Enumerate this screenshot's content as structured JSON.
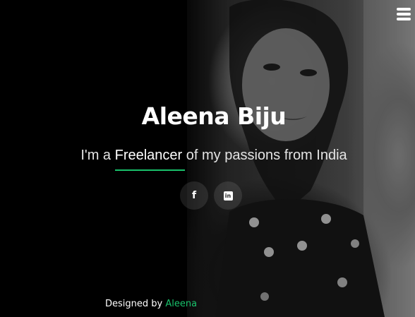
{
  "header": {
    "menu_icon": "hamburger-menu-icon"
  },
  "hero": {
    "name": "Aleena Biju",
    "tagline_prefix": "I'm a ",
    "tagline_highlight": "Freelancer",
    "tagline_suffix": " of my passions from India",
    "accent_color": "#19c26b"
  },
  "socials": [
    {
      "icon": "facebook-icon",
      "glyph": "f"
    },
    {
      "icon": "linkedin-icon",
      "glyph": "in"
    }
  ],
  "footer": {
    "prefix": "Designed by ",
    "author": "Aleena"
  }
}
